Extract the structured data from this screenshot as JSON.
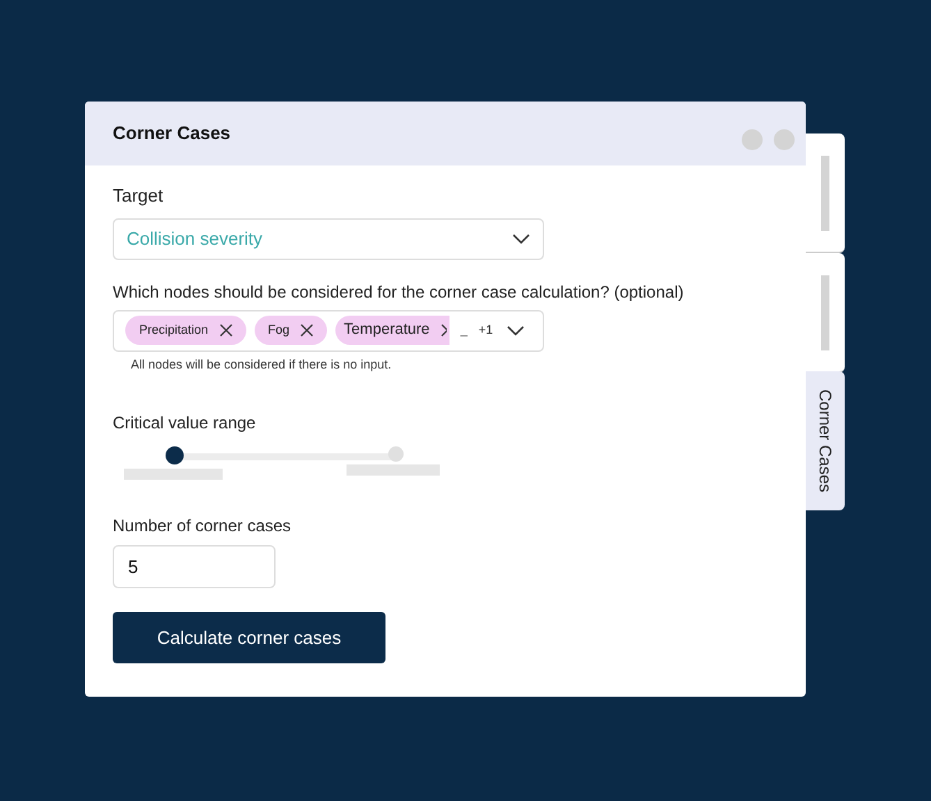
{
  "window": {
    "title": "Corner Cases"
  },
  "target": {
    "label": "Target",
    "value": "Collision severity"
  },
  "nodes": {
    "label": "Which nodes should be considered for the corner case calculation? (optional)",
    "chips": [
      {
        "label": "Precipitation"
      },
      {
        "label": "Fog"
      },
      {
        "label": "Temperature"
      }
    ],
    "cursor": "_",
    "more": "+1",
    "hint": "All nodes will be considered if there is no input."
  },
  "range": {
    "label": "Critical value range",
    "thumbs": [
      {
        "level": 0,
        "selected": true
      },
      {
        "level": 1,
        "selected": false
      }
    ]
  },
  "count": {
    "label": "Number of corner cases",
    "value": "5"
  },
  "button": "Calculate corner cases",
  "side_tabs": [
    {
      "selected": false
    },
    {
      "selected": false
    },
    {
      "label": "Corner Cases",
      "selected": true
    }
  ]
}
